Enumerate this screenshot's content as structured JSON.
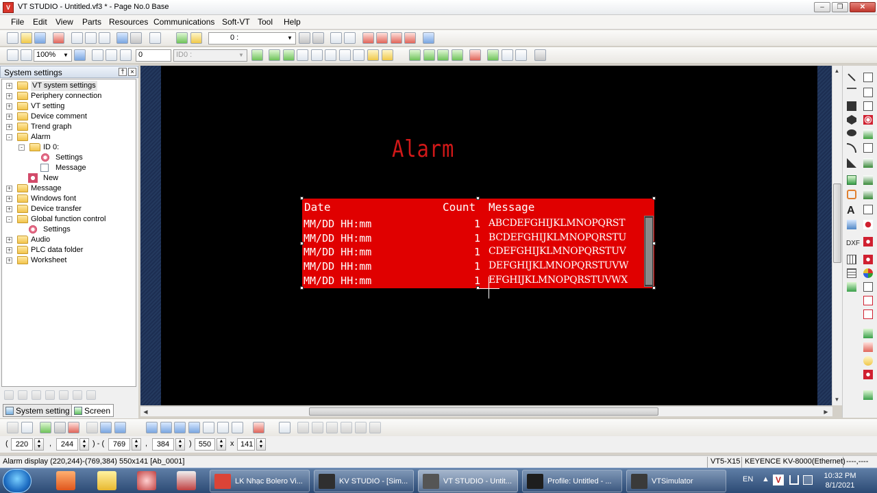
{
  "window": {
    "title": "VT STUDIO - Untitled.vf3 * - Page No.0 Base",
    "app_icon_text": "V"
  },
  "menu": [
    "File",
    "Edit",
    "View",
    "Parts",
    "Resources",
    "Communications",
    "Soft-VT",
    "Tool",
    "Help"
  ],
  "toolbar1": {
    "page_combo": "0 :"
  },
  "toolbar2": {
    "zoom": "100%",
    "page_no": "0",
    "id_combo": "ID0 :"
  },
  "left_panel": {
    "header": "System settings",
    "tree": [
      {
        "label": "VT system settings",
        "level": 0,
        "icon": "folder",
        "exp": "+",
        "selected": true
      },
      {
        "label": "Periphery connection",
        "level": 0,
        "icon": "folder",
        "exp": "+"
      },
      {
        "label": "VT setting",
        "level": 0,
        "icon": "folder",
        "exp": "+"
      },
      {
        "label": "Device comment",
        "level": 0,
        "icon": "folder",
        "exp": "+"
      },
      {
        "label": "Trend graph",
        "level": 0,
        "icon": "folder",
        "exp": "+"
      },
      {
        "label": "Alarm",
        "level": 0,
        "icon": "folder",
        "exp": "-"
      },
      {
        "label": "ID 0:",
        "level": 1,
        "icon": "folder",
        "exp": "-"
      },
      {
        "label": "Settings",
        "level": 2,
        "icon": "gear"
      },
      {
        "label": "Message",
        "level": 2,
        "icon": "msg"
      },
      {
        "label": "New",
        "level": 1,
        "icon": "new"
      },
      {
        "label": "Message",
        "level": 0,
        "icon": "folder",
        "exp": "+"
      },
      {
        "label": "Windows font",
        "level": 0,
        "icon": "folder",
        "exp": "+"
      },
      {
        "label": "Device transfer",
        "level": 0,
        "icon": "folder",
        "exp": "+"
      },
      {
        "label": "Global function control",
        "level": 0,
        "icon": "folder",
        "exp": "-"
      },
      {
        "label": "Settings",
        "level": 1,
        "icon": "gear"
      },
      {
        "label": "Audio",
        "level": 0,
        "icon": "folder",
        "exp": "+"
      },
      {
        "label": "PLC data folder",
        "level": 0,
        "icon": "folder",
        "exp": "+"
      },
      {
        "label": "Worksheet",
        "level": 0,
        "icon": "folder",
        "exp": "+"
      }
    ],
    "tabs": {
      "system": "System setting",
      "screen": "Screen"
    }
  },
  "canvas": {
    "title": "Alarm",
    "columns": {
      "date": "Date",
      "count": "Count",
      "message": "Message"
    },
    "rows": [
      {
        "date": "MM/DD HH:mm",
        "count": "1",
        "message": "ABCDEFGHIJKLMNOPQRST"
      },
      {
        "date": "MM/DD HH:mm",
        "count": "1",
        "message": "BCDEFGHIJKLMNOPQRSTU"
      },
      {
        "date": "MM/DD HH:mm",
        "count": "1",
        "message": "CDEFGHIJKLMNOPQRSTUV"
      },
      {
        "date": "MM/DD HH:mm",
        "count": "1",
        "message": "DEFGHIJKLMNOPQRSTUVW"
      },
      {
        "date": "MM/DD HH:mm",
        "count": "1",
        "message": "EFGHIJKLMNOPQRSTUVWX"
      }
    ],
    "colors": {
      "background": "#000000",
      "title": "#d01818",
      "box": "#e00000",
      "text": "#ffffff"
    }
  },
  "coords": {
    "open1": "(",
    "x1": "220",
    "sep1": ",",
    "y1": "244",
    "mid": ") - (",
    "x2": "769",
    "sep2": ",",
    "y2": "384",
    "close": ")",
    "w": "550",
    "times": "x",
    "h": "141"
  },
  "status": {
    "text": "Alarm display (220,244)-(769,384) 550x141 [Ab_0001]",
    "model": "VT5-X15",
    "plc": "KEYENCE KV-8000(Ethernet)",
    "extra": "----,----"
  },
  "taskbar": {
    "tasks": [
      {
        "label": "LK Nhạc Bolero Vi...",
        "icon_color": "#db4437"
      },
      {
        "label": "KV STUDIO - [Sim...",
        "icon_color": "#2f2f2f"
      },
      {
        "label": "VT STUDIO - Untit...",
        "icon_color": "#555555",
        "active": true
      },
      {
        "label": "Profile: Untitled - ...",
        "icon_color": "#1e1e1e"
      },
      {
        "label": "VTSimulator",
        "icon_color": "#3a3a3a"
      }
    ],
    "lang": "EN",
    "time": "10:32 PM",
    "date": "8/1/2021"
  }
}
